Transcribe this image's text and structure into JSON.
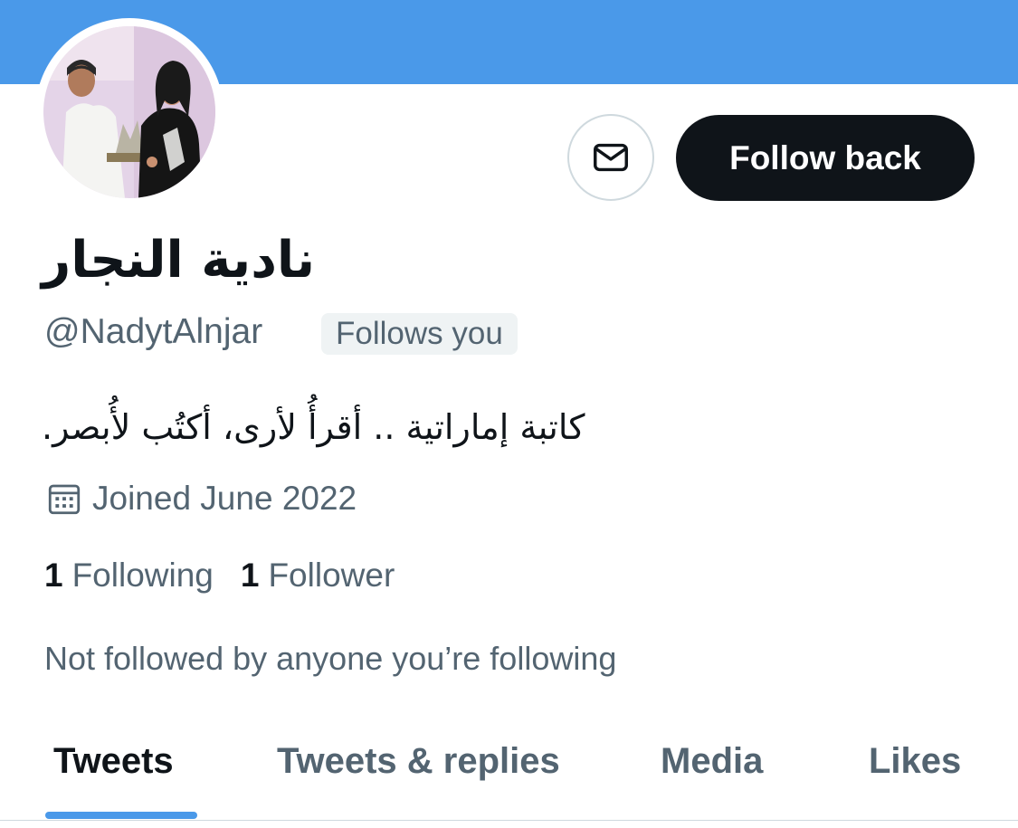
{
  "colors": {
    "banner": "#4a99e9",
    "primary_text": "#0f1419",
    "secondary_text": "#536471",
    "accent": "#4a99e9"
  },
  "profile": {
    "display_name": "نادية النجار",
    "handle": "@NadytAlnjar",
    "follows_you_badge": "Follows you",
    "bio": "كاتبة إماراتية .. أقرأُ لأرى، أكتُب لأُبصر.",
    "joined": "Joined June 2022",
    "avatar_icon": "profile-photo"
  },
  "actions": {
    "message_icon": "envelope-icon",
    "follow_back_label": "Follow back"
  },
  "stats": {
    "following_count": "1",
    "following_label": "Following",
    "followers_count": "1",
    "followers_label": "Follower"
  },
  "social_context": "Not followed by anyone you’re following",
  "tabs": [
    {
      "label": "Tweets",
      "active": true
    },
    {
      "label": "Tweets & replies",
      "active": false
    },
    {
      "label": "Media",
      "active": false
    },
    {
      "label": "Likes",
      "active": false
    }
  ]
}
